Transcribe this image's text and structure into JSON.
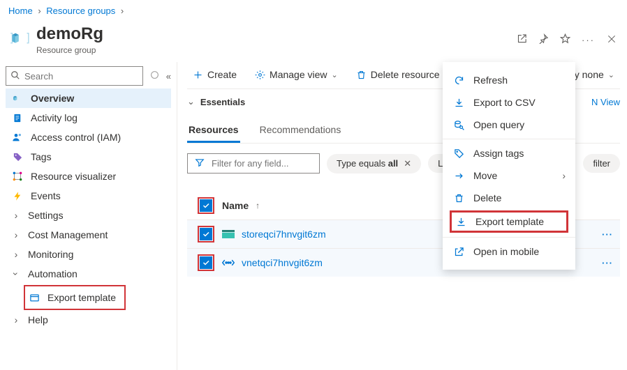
{
  "breadcrumb": {
    "home": "Home",
    "rg": "Resource groups"
  },
  "header": {
    "title": "demoRg",
    "subtitle": "Resource group"
  },
  "search": {
    "placeholder": "Search"
  },
  "nav": {
    "overview": "Overview",
    "activity": "Activity log",
    "iam": "Access control (IAM)",
    "tags": "Tags",
    "resvis": "Resource visualizer",
    "events": "Events",
    "settings": "Settings",
    "cost": "Cost Management",
    "monitoring": "Monitoring",
    "automation": "Automation",
    "export": "Export template",
    "help": "Help"
  },
  "toolbar": {
    "create": "Create",
    "manage": "Manage view",
    "delete": "Delete resource group",
    "groupby": "Group by none"
  },
  "essentials": {
    "label": "Essentials",
    "json": "N View"
  },
  "tabs": {
    "resources": "Resources",
    "recs": "Recommendations"
  },
  "filters": {
    "placeholder": "Filter for any field...",
    "type_pill": {
      "label": "Type equals ",
      "val": "all"
    },
    "loc_pill": "Locat",
    "add": "filter"
  },
  "table": {
    "header_name": "Name",
    "rows": [
      {
        "name": "storeqci7hnvgit6zm",
        "kind": "storage"
      },
      {
        "name": "vnetqci7hnvgit6zm",
        "kind": "vnet"
      }
    ]
  },
  "menu": {
    "refresh": "Refresh",
    "csv": "Export to CSV",
    "query": "Open query",
    "assign": "Assign tags",
    "move": "Move",
    "delete": "Delete",
    "export": "Export template",
    "mobile": "Open in mobile"
  }
}
